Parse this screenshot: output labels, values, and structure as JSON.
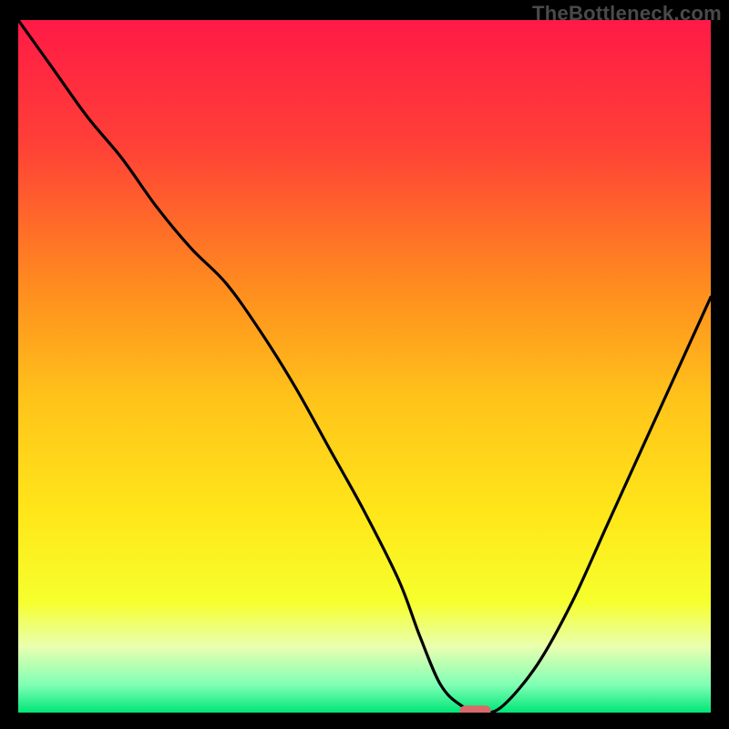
{
  "watermark": "TheBottleneck.com",
  "colors": {
    "background": "#000000",
    "curve": "#000000",
    "marker_fill": "#d96a6a",
    "gradient_stops": [
      {
        "offset": 0.0,
        "color": "#ff1a46"
      },
      {
        "offset": 0.18,
        "color": "#ff4037"
      },
      {
        "offset": 0.38,
        "color": "#ff8a1f"
      },
      {
        "offset": 0.55,
        "color": "#ffc41a"
      },
      {
        "offset": 0.72,
        "color": "#ffe81a"
      },
      {
        "offset": 0.84,
        "color": "#f6ff2d"
      },
      {
        "offset": 0.905,
        "color": "#e9ffb0"
      },
      {
        "offset": 0.96,
        "color": "#7fffb5"
      },
      {
        "offset": 1.0,
        "color": "#00e676"
      }
    ]
  },
  "chart_data": {
    "type": "line",
    "title": "",
    "xlabel": "",
    "ylabel": "",
    "xlim": [
      0,
      100
    ],
    "ylim": [
      0,
      100
    ],
    "legend": null,
    "annotations": [],
    "series": [
      {
        "name": "bottleneck-curve",
        "x": [
          0,
          5,
          10,
          15,
          20,
          25,
          30,
          35,
          40,
          45,
          50,
          55,
          58,
          61,
          64,
          67,
          70,
          75,
          80,
          85,
          90,
          95,
          100
        ],
        "y": [
          100,
          93,
          86,
          80,
          73,
          67,
          62,
          55,
          47,
          38,
          29,
          19,
          11,
          4,
          1,
          0,
          1,
          7,
          16,
          27,
          38,
          49,
          60
        ]
      }
    ],
    "marker": {
      "x": 66,
      "y": 0,
      "width": 4.5,
      "height": 1.5
    }
  }
}
